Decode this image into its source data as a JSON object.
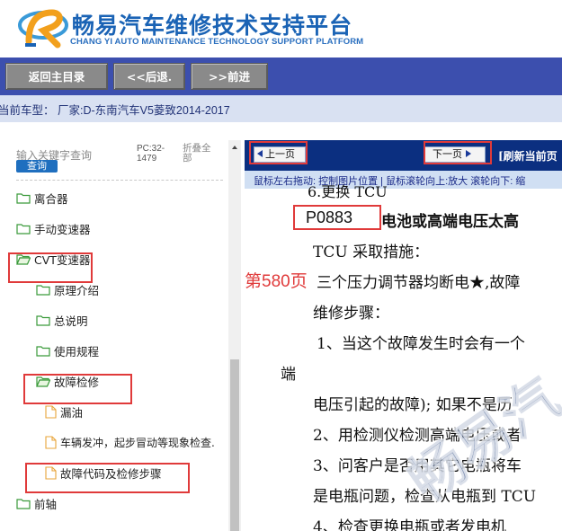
{
  "brand": {
    "title": "畅易汽车维修技术支持平台",
    "subtitle": "CHANG YI AUTO MAINTENANCE TECHNOLOGY SUPPORT PLATFORM"
  },
  "nav": {
    "home": "返回主目录",
    "back": "<<后退.",
    "forward": ">>前进"
  },
  "vehicle": "当前车型： 厂家:D-东南汽车V5菱致2014-2017",
  "sidebar": {
    "search_placeholder": "输入关键字查询",
    "query_button": "查询",
    "pc_info": "PC:32-1479",
    "collapse_all": "折叠全部",
    "items": [
      {
        "label": "离合器",
        "type": "folder"
      },
      {
        "label": "手动变速器",
        "type": "folder"
      },
      {
        "label": "CVT变速器",
        "type": "folder-open"
      },
      {
        "label": "原理介绍",
        "type": "folder"
      },
      {
        "label": "总说明",
        "type": "folder"
      },
      {
        "label": "使用规程",
        "type": "folder"
      },
      {
        "label": "故障检修",
        "type": "folder-open"
      },
      {
        "label": "漏油",
        "type": "doc"
      },
      {
        "label": "车辆发冲，起步冒动等现象检查.",
        "type": "doc"
      },
      {
        "label": "故障代码及检修步骤",
        "type": "doc"
      },
      {
        "label": "前轴",
        "type": "folder"
      }
    ]
  },
  "viewer": {
    "prev": "上一页",
    "next": "下一页",
    "refresh": "[刷新当前页",
    "hint": "鼠标左右拖动: 控制图片位置 | 鼠标滚轮向上:放大  滚轮向下: 缩",
    "page_label": "第580页",
    "doc_lines": [
      "6.更换 TCU",
      "P0883",
      "电池或高端电压太高",
      "TCU 采取措施：",
      "三个压力调节器均断电★,故障",
      "维修步骤：",
      "1、当这个故障发生时会有一个",
      "端",
      "电压引起的故障); 如果不是历",
      "2、用检测仪检测高端电压或者",
      "3、问客户是否用其它电瓶将车",
      "是电瓶问题，检查从电瓶到 TCU",
      "4、检查更换电瓶或者发电机"
    ],
    "watermark": "畅易汽"
  },
  "colors": {
    "nav_bg": "#3c4fae",
    "pager_bg": "#0b2f80",
    "highlight": "#e03a3a",
    "brand": "#1a63b5"
  }
}
